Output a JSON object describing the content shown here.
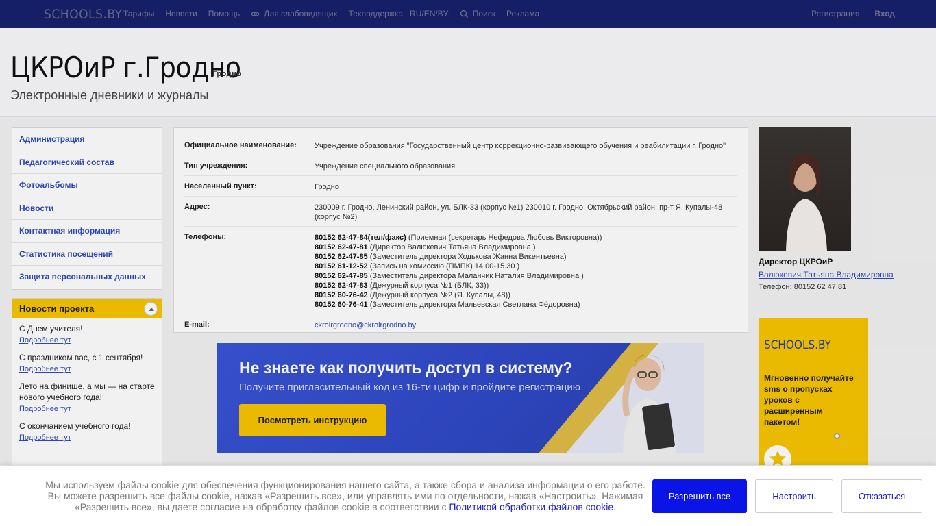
{
  "topbar": {
    "logo": "SCHOOLS.BY",
    "nav": [
      "Тарифы",
      "Новости",
      "Помощь",
      "Для слабовидящих",
      "Техподдержка",
      "RU/EN/BY",
      "Поиск",
      "Реклама"
    ],
    "register": "Регистрация",
    "login": "Вход"
  },
  "header": {
    "title": "ЦКРОиР г.Гродно",
    "city": "Гродно",
    "subtitle": "Электронные дневники и журналы"
  },
  "sidebar": {
    "items": [
      {
        "label": "Администрация"
      },
      {
        "label": "Педагогический состав"
      },
      {
        "label": "Фотоальбомы"
      },
      {
        "label": "Новости"
      },
      {
        "label": "Контактная информация"
      },
      {
        "label": "Статистика посещений"
      },
      {
        "label": "Защита персональных данных"
      }
    ]
  },
  "news": {
    "title": "Новости проекта",
    "more": "Подробнее тут",
    "items": [
      {
        "title": "С Днем учителя!"
      },
      {
        "title": "С праздником вас, с 1 сентября!"
      },
      {
        "title": "Лето на финише, а мы — на старте нового учебного года!"
      },
      {
        "title": "С окончанием учебного года!"
      }
    ]
  },
  "info": {
    "official_label": "Официальное наименование:",
    "official_value": "Учреждение образования \"Государственный центр коррекционно-развивающего обучения и реабилитации г. Гродно\"",
    "type_label": "Тип учреждения:",
    "type_value": "Учреждение специального образования",
    "city_label": "Населенный пункт:",
    "city_value": "Гродно",
    "address_label": "Адрес:",
    "address_value": "230009 г. Гродно, Ленинский район, ул. БЛК-33 (корпус №1) 230010 г. Гродно, Октябрьский район, пр-т Я. Купалы-48 (корпус №2)",
    "phones_label": "Телефоны:",
    "phones": [
      {
        "num": "80152 62-47-84(тел/факс)",
        "desc": " (Приемная (секретарь Нефедова Любовь Викторовна))"
      },
      {
        "num": "80152 62-47-81",
        "desc": " (Директор Валюкевич Татьяна Владимировна )"
      },
      {
        "num": "80152 62-47-85",
        "desc": " (Заместитель директора Ходькова Жанна Викентьевна)"
      },
      {
        "num": "80152 61-12-52",
        "desc": " (Запись на комиссию (ПМПК) 14.00-15.30 )"
      },
      {
        "num": "80152 62-47-85",
        "desc": " (Заместитель директора Маланчик Наталия Владимировна )"
      },
      {
        "num": "80152 62-47-83",
        "desc": " (Дежурный корпуса №1 (БЛК, 33))"
      },
      {
        "num": "80152 60-76-42",
        "desc": " (Дежурный корпуса №2 (Я. Купалы, 48))"
      },
      {
        "num": "80152 60-76-41",
        "desc": " (Заместитель директора Мальевская Светлана Фёдоровна)"
      }
    ],
    "email_label": "E-mail:",
    "email_value": "ckroirgrodno@ckroirgrodno.by"
  },
  "banner": {
    "heading": "Не знаете как получить доступ в систему?",
    "sub": "Получите пригласительный код из 16-ти цифр и пройдите регистрацию",
    "button": "Посмотреть инструкцию"
  },
  "director": {
    "title": "Директор ЦКРОиР",
    "name": "Валюкевич Татьяна Владимировна",
    "phone": "Телефон: 80152 62 47 81"
  },
  "ad": {
    "logo": "SCHOOLS.BY",
    "text": "Мгновенно получайте sms о пропусках уроков с расширенным пакетом!"
  },
  "cookie": {
    "text": "Мы используем файлы cookie для обеспечения функционирования нашего сайта, а также сбора и анализа информации о его работе. Вы можете разрешить все файлы cookie, нажав «Разрешить все», или управлять ими по отдельности, нажав «Настроить». Нажимая «Разрешить все», вы даете согласие на обработку файлов cookie в соответствии с ",
    "link": "Политикой обработки файлов cookie",
    "tail": ".",
    "allow": "Разрешить все",
    "configure": "Настроить",
    "decline": "Отказаться"
  },
  "colors": {
    "topbar": "#2a3da1",
    "accent": "#f7c500",
    "link": "#2f4cc0",
    "primary_button": "#0a14e6"
  }
}
